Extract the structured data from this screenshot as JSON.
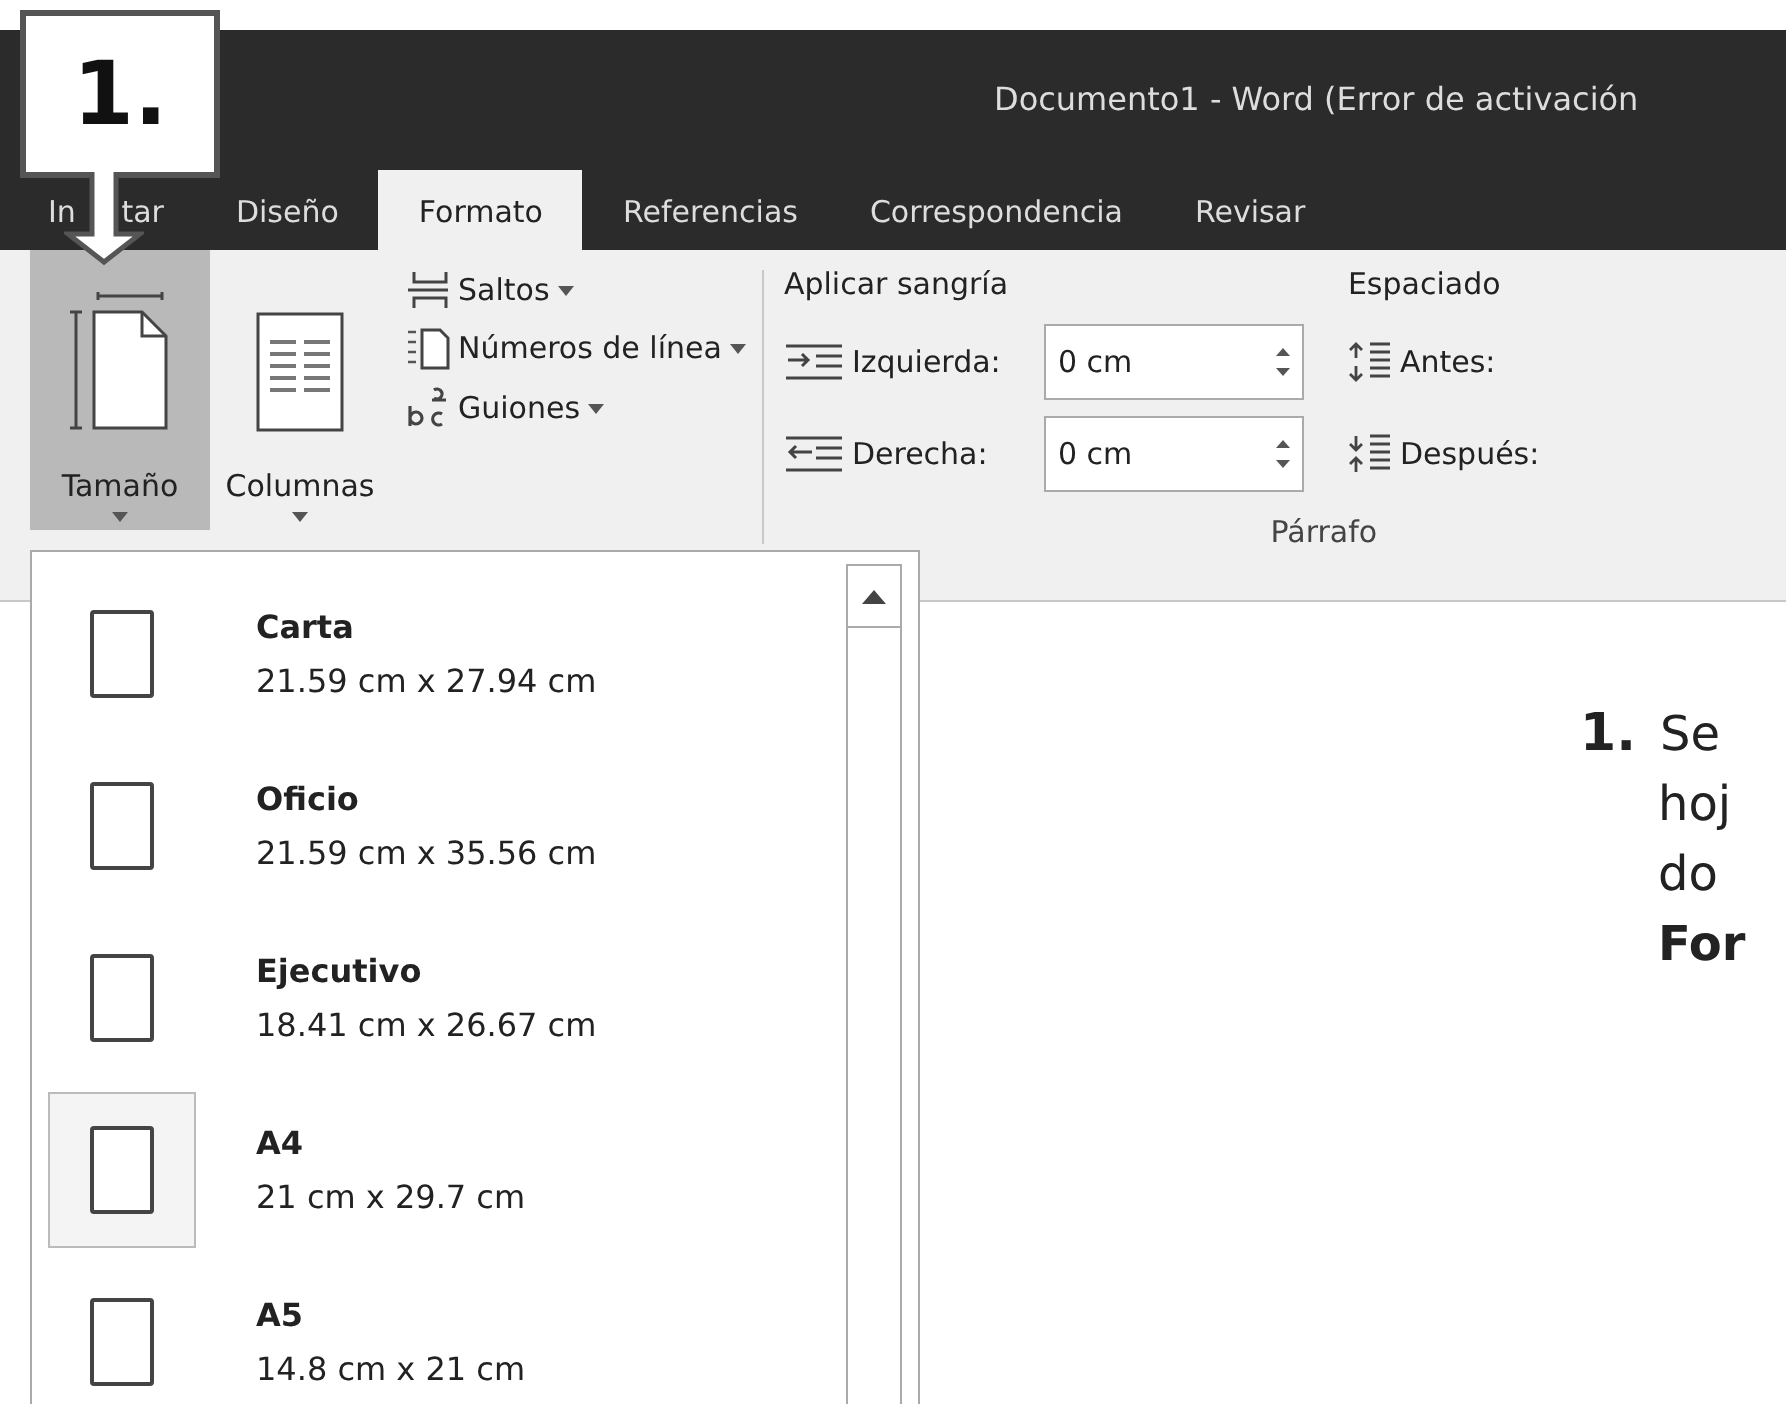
{
  "window": {
    "title": "Documento1 - Word (Error de activación"
  },
  "callout": {
    "number": "1."
  },
  "tabs": [
    {
      "label": "In",
      "label_tail": "tar",
      "selected": false
    },
    {
      "label": "Diseño",
      "selected": false
    },
    {
      "label": "Formato",
      "selected": true
    },
    {
      "label": "Referencias",
      "selected": false
    },
    {
      "label": "Correspondencia",
      "selected": false
    },
    {
      "label": "Revisar",
      "selected": false
    }
  ],
  "ribbon": {
    "large_buttons": [
      {
        "label": "Tamaño",
        "selected": true
      },
      {
        "label": "Columnas",
        "selected": false
      }
    ],
    "small_buttons": [
      "Saltos",
      "Números de línea",
      "Guiones"
    ],
    "indent_title": "Aplicar sangría",
    "indent": [
      {
        "label": "Izquierda:",
        "value": "0 cm"
      },
      {
        "label": "Derecha:",
        "value": "0 cm"
      }
    ],
    "spacing_title": "Espaciado",
    "spacing": [
      "Antes:",
      "Después:"
    ],
    "group_label": "Párrafo"
  },
  "size_menu": {
    "items": [
      {
        "name": "Carta",
        "size": "21.59 cm x 27.94 cm",
        "selected": false
      },
      {
        "name": "Oficio",
        "size": "21.59 cm x 35.56 cm",
        "selected": false
      },
      {
        "name": "Ejecutivo",
        "size": "18.41 cm x 26.67 cm",
        "selected": false
      },
      {
        "name": "A4",
        "size": "21 cm x 29.7 cm",
        "selected": true
      },
      {
        "name": "A5",
        "size": "14.8 cm x 21 cm",
        "selected": false
      }
    ]
  },
  "instruction": {
    "number": "1.",
    "lines": [
      {
        "text": "Se",
        "bold": false
      },
      {
        "text": "hoj",
        "bold": false
      },
      {
        "text": "do",
        "bold": false
      },
      {
        "text": "For",
        "bold": true
      }
    ]
  }
}
